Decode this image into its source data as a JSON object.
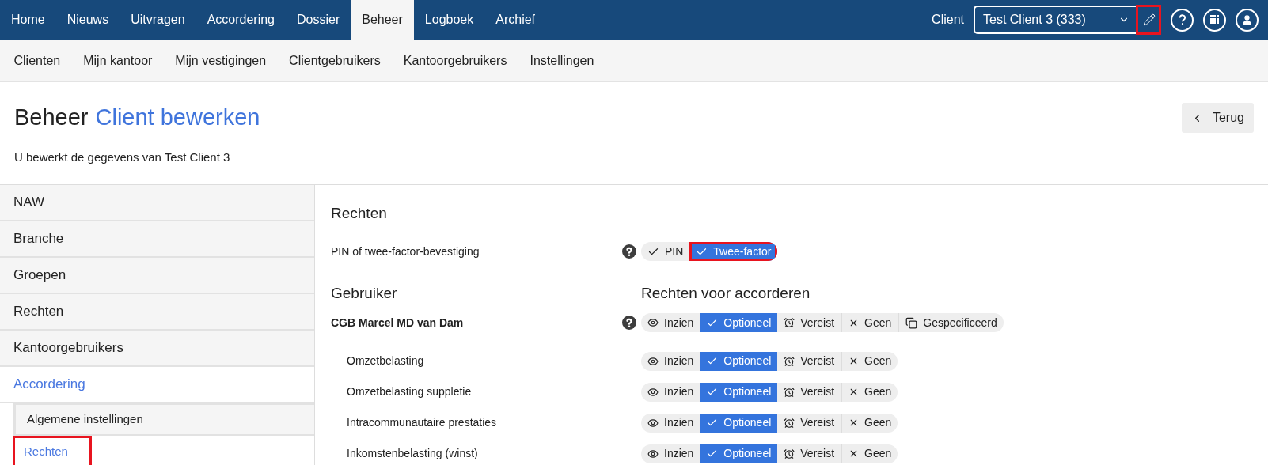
{
  "top_nav": {
    "tabs": [
      {
        "label": "Home",
        "selected": false
      },
      {
        "label": "Nieuws",
        "selected": false
      },
      {
        "label": "Uitvragen",
        "selected": false
      },
      {
        "label": "Accordering",
        "selected": false
      },
      {
        "label": "Dossier",
        "selected": false
      },
      {
        "label": "Beheer",
        "selected": true
      },
      {
        "label": "Logboek",
        "selected": false
      },
      {
        "label": "Archief",
        "selected": false
      }
    ],
    "client_label": "Client",
    "client_select": {
      "value": "Test Client 3 (333)"
    },
    "edit_highlighted": true
  },
  "sub_nav": [
    "Clienten",
    "Mijn kantoor",
    "Mijn vestigingen",
    "Clientgebruikers",
    "Kantoorgebruikers",
    "Instellingen"
  ],
  "header": {
    "section": "Beheer",
    "title": "Client bewerken",
    "subtitle": "U bewerkt de gegevens van Test Client 3",
    "back_button": "Terug"
  },
  "sidebar": {
    "items": [
      {
        "label": "NAW",
        "selected": false
      },
      {
        "label": "Branche",
        "selected": false
      },
      {
        "label": "Groepen",
        "selected": false
      },
      {
        "label": "Rechten",
        "selected": false
      },
      {
        "label": "Kantoorgebruikers",
        "selected": false
      },
      {
        "label": "Accordering",
        "selected": true,
        "children": [
          {
            "label": "Algemene instellingen",
            "selected": false,
            "highlighted": false
          },
          {
            "label": "Rechten",
            "selected": true,
            "highlighted": true
          }
        ]
      }
    ]
  },
  "main": {
    "title": "Rechten",
    "pin_setting": {
      "label": "PIN of twee-factor-bevestiging",
      "options": [
        {
          "label": "PIN",
          "selected": false,
          "highlighted": false
        },
        {
          "label": "Twee-factor",
          "selected": true,
          "highlighted": true
        }
      ]
    },
    "user_heading": "Gebruiker",
    "rights_heading": "Rechten voor accorderen",
    "rows": [
      {
        "label": "CGB Marcel MD van Dam",
        "kind": "user",
        "options": [
          {
            "kind": "view",
            "label": "Inzien",
            "selected": false
          },
          {
            "kind": "optional",
            "label": "Optioneel",
            "selected": true
          },
          {
            "kind": "required",
            "label": "Vereist",
            "selected": false
          },
          {
            "kind": "none",
            "label": "Geen",
            "selected": false
          },
          {
            "kind": "specified",
            "label": "Gespecificeerd",
            "selected": false
          }
        ]
      },
      {
        "label": "Omzetbelasting",
        "kind": "task",
        "options": [
          {
            "kind": "view",
            "label": "Inzien",
            "selected": false
          },
          {
            "kind": "optional",
            "label": "Optioneel",
            "selected": true
          },
          {
            "kind": "required",
            "label": "Vereist",
            "selected": false
          },
          {
            "kind": "none",
            "label": "Geen",
            "selected": false
          }
        ]
      },
      {
        "label": "Omzetbelasting suppletie",
        "kind": "task",
        "options": [
          {
            "kind": "view",
            "label": "Inzien",
            "selected": false
          },
          {
            "kind": "optional",
            "label": "Optioneel",
            "selected": true
          },
          {
            "kind": "required",
            "label": "Vereist",
            "selected": false
          },
          {
            "kind": "none",
            "label": "Geen",
            "selected": false
          }
        ]
      },
      {
        "label": "Intracommunautaire prestaties",
        "kind": "task",
        "options": [
          {
            "kind": "view",
            "label": "Inzien",
            "selected": false
          },
          {
            "kind": "optional",
            "label": "Optioneel",
            "selected": true
          },
          {
            "kind": "required",
            "label": "Vereist",
            "selected": false
          },
          {
            "kind": "none",
            "label": "Geen",
            "selected": false
          }
        ]
      },
      {
        "label": "Inkomstenbelasting (winst)",
        "kind": "task",
        "options": [
          {
            "kind": "view",
            "label": "Inzien",
            "selected": false
          },
          {
            "kind": "optional",
            "label": "Optioneel",
            "selected": true
          },
          {
            "kind": "required",
            "label": "Vereist",
            "selected": false
          },
          {
            "kind": "none",
            "label": "Geen",
            "selected": false
          }
        ]
      }
    ]
  }
}
